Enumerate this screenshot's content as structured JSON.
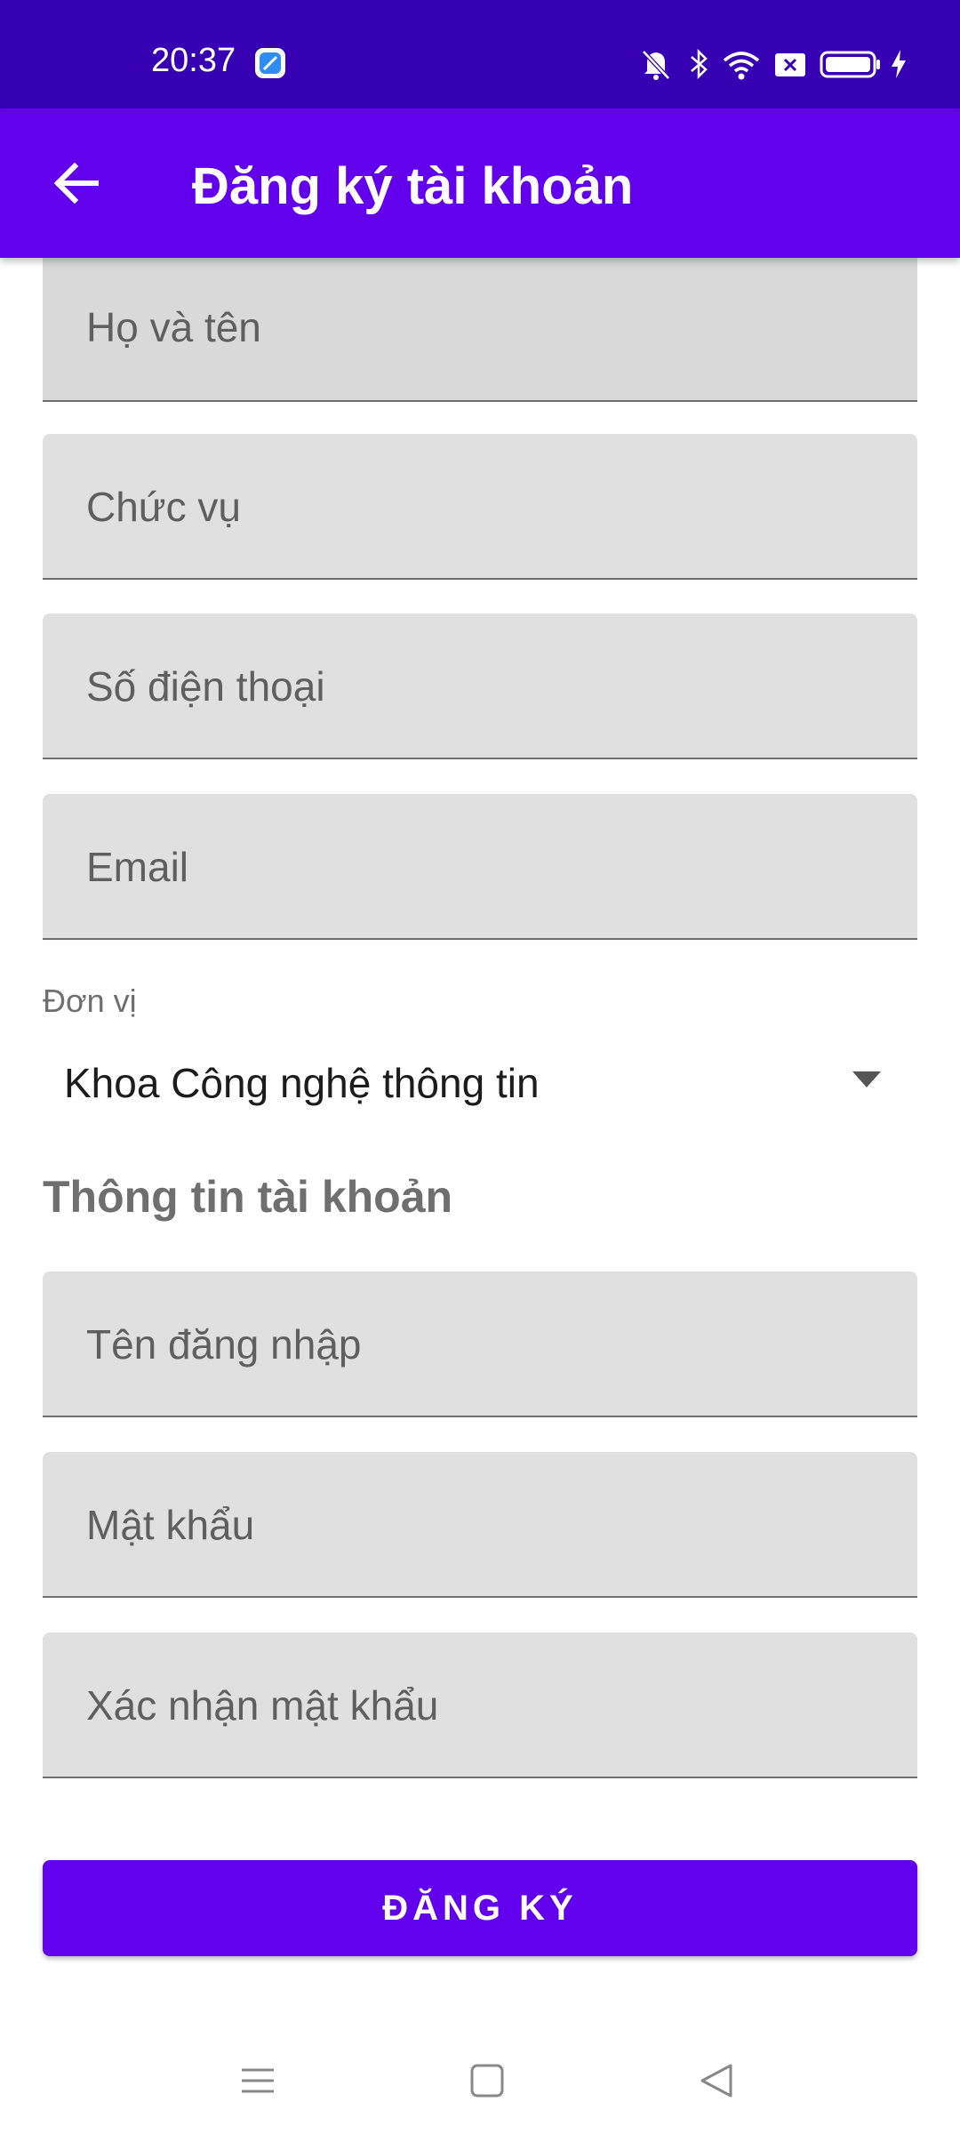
{
  "colors": {
    "status_bar": "#3700b3",
    "primary": "#6200ee",
    "field_background": "#e0e0e0",
    "field_text": "#5f5f5f"
  },
  "status_bar": {
    "time": "20:37",
    "icons": [
      "app-notification-icon",
      "bell-off-icon",
      "bluetooth-icon",
      "wifi-icon",
      "sim-off-icon",
      "battery-icon",
      "charging-icon"
    ]
  },
  "app_bar": {
    "title": "Đăng ký tài khoản",
    "back_icon": "arrow-left-icon"
  },
  "form": {
    "fields": [
      {
        "label": "Họ và tên"
      },
      {
        "label": "Chức vụ"
      },
      {
        "label": "Số điện thoại"
      },
      {
        "label": "Email"
      }
    ],
    "unit": {
      "label": "Đơn vị",
      "selected": "Khoa Công nghệ thông tin"
    },
    "account_section_title": "Thông tin tài khoản",
    "account_fields": [
      {
        "label": "Tên đăng nhập"
      },
      {
        "label": "Mật khẩu"
      },
      {
        "label": "Xác nhận mật khẩu"
      }
    ],
    "submit_label": "ĐĂNG KÝ"
  },
  "nav_bar": {
    "buttons": [
      "menu-icon",
      "home-icon",
      "back-triangle-icon"
    ]
  }
}
